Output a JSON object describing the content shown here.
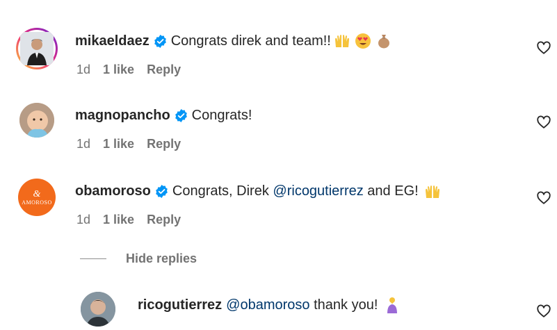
{
  "comments": [
    {
      "username": "mikaeldaez",
      "text": "Congrats direk and team!!",
      "time": "1d",
      "likes": "1 like",
      "reply": "Reply"
    },
    {
      "username": "magnopancho",
      "text": "Congrats!",
      "time": "1d",
      "likes": "1 like",
      "reply": "Reply"
    },
    {
      "username": "obamoroso",
      "text_before": "Congrats, Direk ",
      "mention": "@ricogutierrez",
      "text_after": " and EG!",
      "time": "1d",
      "likes": "1 like",
      "reply": "Reply",
      "avatar_text": "AMOROSO"
    }
  ],
  "hide_replies": "Hide replies",
  "reply_comment": {
    "username": "ricogutierrez",
    "mention": "@obamoroso",
    "text": " thank you!"
  },
  "colors": {
    "verified": "#0095f6",
    "mention": "#00376b",
    "meta": "#737373",
    "amoroso_orange": "#f26a1b"
  }
}
